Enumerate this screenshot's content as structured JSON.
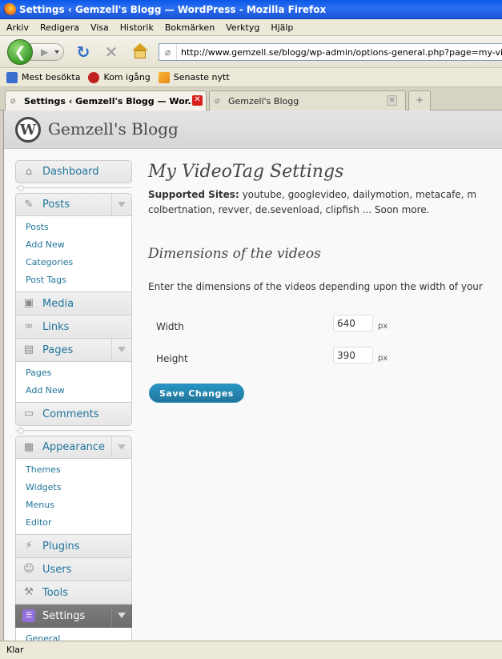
{
  "window": {
    "title": "Settings ‹ Gemzell's Blogg — WordPress - Mozilla Firefox"
  },
  "menubar": {
    "items": [
      "Arkiv",
      "Redigera",
      "Visa",
      "Historik",
      "Bokmärken",
      "Verktyg",
      "Hjälp"
    ]
  },
  "navbar": {
    "url": "http://www.gemzell.se/blogg/wp-admin/options-general.php?page=my-videotag.p"
  },
  "bookmarks": {
    "items": [
      "Mest besökta",
      "Kom igång",
      "Senaste nytt"
    ]
  },
  "tabs": [
    {
      "label": "Settings ‹ Gemzell's Blogg — Wor...",
      "active": true
    },
    {
      "label": "Gemzell's Blogg",
      "active": false
    }
  ],
  "site": {
    "logo_letter": "W",
    "title": "Gemzell's Blogg"
  },
  "admin_menu": {
    "dashboard": "Dashboard",
    "posts": {
      "label": "Posts",
      "sub": [
        "Posts",
        "Add New",
        "Categories",
        "Post Tags"
      ]
    },
    "media": "Media",
    "links": "Links",
    "pages": {
      "label": "Pages",
      "sub": [
        "Pages",
        "Add New"
      ]
    },
    "comments": "Comments",
    "appearance": {
      "label": "Appearance",
      "sub": [
        "Themes",
        "Widgets",
        "Menus",
        "Editor"
      ]
    },
    "plugins": "Plugins",
    "users": "Users",
    "tools": "Tools",
    "settings": {
      "label": "Settings",
      "sub": [
        "General"
      ]
    }
  },
  "main": {
    "title": "My VideoTag Settings",
    "supported_label": "Supported Sites:",
    "supported_line1": "youtube, googlevideo, dailymotion, metacafe, m",
    "supported_line2": "colbertnation, revver, de.sevenload, clipfish ... Soon more.",
    "section_title": "Dimensions of the videos",
    "description": "Enter the dimensions of the videos depending upon the width of your",
    "width_label": "Width",
    "width_value": "640",
    "height_label": "Height",
    "height_value": "390",
    "unit": "px",
    "save_label": "Save Changes"
  },
  "statusbar": {
    "text": "Klar"
  }
}
